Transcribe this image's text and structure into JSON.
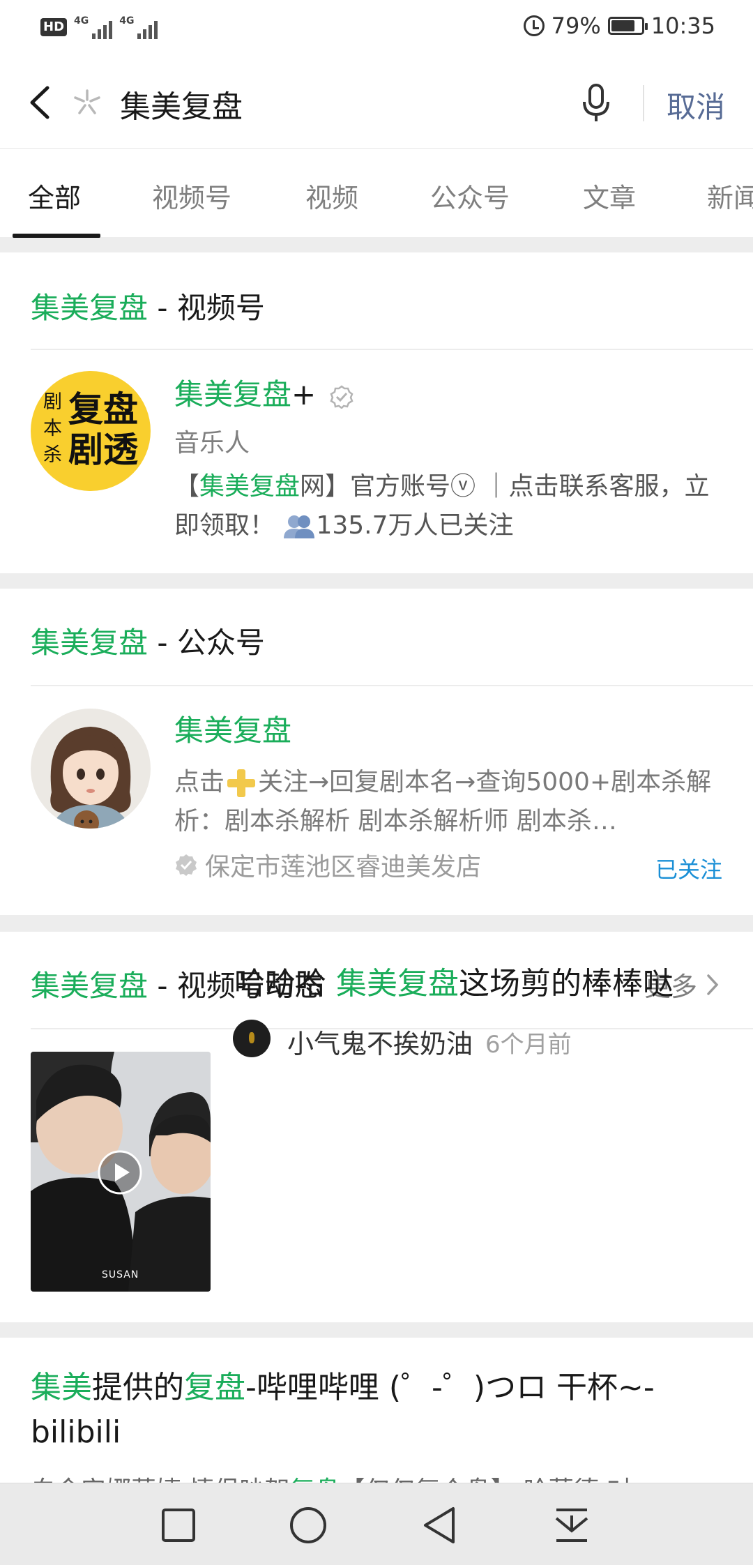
{
  "status_bar": {
    "hd": "HD",
    "net1": "4G",
    "net2": "4G",
    "battery": "79%",
    "time": "10:35",
    "battery_level": 0.79
  },
  "search": {
    "query": "集美复盘",
    "cancel": "取消"
  },
  "tabs": [
    {
      "label": "全部",
      "active": true
    },
    {
      "label": "视频号"
    },
    {
      "label": "视频"
    },
    {
      "label": "公众号"
    },
    {
      "label": "文章"
    },
    {
      "label": "新闻"
    }
  ],
  "channels_section": {
    "head_hl": "集美复盘",
    "head_rest": " - 视频号",
    "account": {
      "name_hl": "集美复盘",
      "name_rest": "+",
      "avatar_small": [
        "剧",
        "本",
        "杀"
      ],
      "avatar_big": [
        "复盘",
        "剧透"
      ],
      "role": "音乐人",
      "desc_a": "【",
      "desc_hl": "集美复盘",
      "desc_b": "网】官方账号ⓥ ｜点击联系客服，立即领取！",
      "followers": "135.7万人已关注"
    }
  },
  "official_section": {
    "head_hl": "集美复盘",
    "head_rest": " - 公众号",
    "account": {
      "name": "集美复盘",
      "desc_a": "点击",
      "desc_b": "关注→回复剧本名→查询5000+剧本杀解析：剧本杀解析 剧本杀解析师 剧本杀…",
      "owner": "保定市莲池区睿迪美发店",
      "follow_status": "已关注"
    }
  },
  "moments_section": {
    "head_hl": "集美复盘",
    "head_rest": " - 视频号动态",
    "more": "更多",
    "video": {
      "title_a": "哈哈哈 ",
      "title_hl": "集美复盘",
      "title_b": "这场剪的棒棒哒",
      "author": "小气鬼不挨奶油",
      "time": "6个月前",
      "watermark": "SUSAN"
    }
  },
  "web_result": {
    "t1_hl": "集美",
    "t2": "提供的",
    "t3_hl": "复盘",
    "t4": "-哔哩哔哩 (゜-゜)つロ 干杯~-bilibili",
    "s1": "白金安娜墓婕 情侣吵架",
    "s2_hl": "复盘",
    "s3": "【仅仅复个盘】 哈蒙德·对"
  },
  "colors": {
    "highlight": "#1aad5a",
    "link_blue": "#576b95",
    "follow_blue": "#1a8fd6"
  }
}
